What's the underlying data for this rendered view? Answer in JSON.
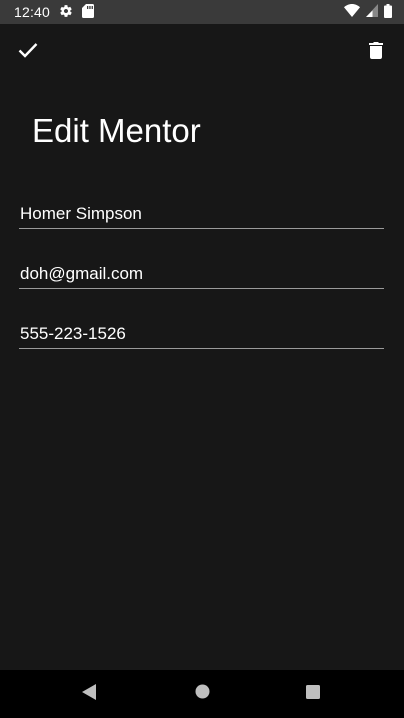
{
  "status_bar": {
    "time": "12:40",
    "left_icons": [
      "settings-icon",
      "sd-card-icon"
    ],
    "right_icons": [
      "wifi-icon",
      "cell-signal-icon",
      "battery-icon"
    ]
  },
  "app_bar": {
    "confirm_icon": "check-icon",
    "delete_icon": "trash-icon"
  },
  "page": {
    "title": "Edit Mentor"
  },
  "form": {
    "name_value": "Homer Simpson",
    "email_value": "doh@gmail.com",
    "phone_value": "555-223-1526"
  },
  "nav_bar": {
    "icons": [
      "back-triangle-icon",
      "home-circle-icon",
      "recents-square-icon"
    ]
  },
  "colors": {
    "background": "#171717",
    "status_bar": "#3a3a3a",
    "nav_bar": "#000000",
    "text": "#ffffff",
    "underline": "#9a9a9a"
  }
}
